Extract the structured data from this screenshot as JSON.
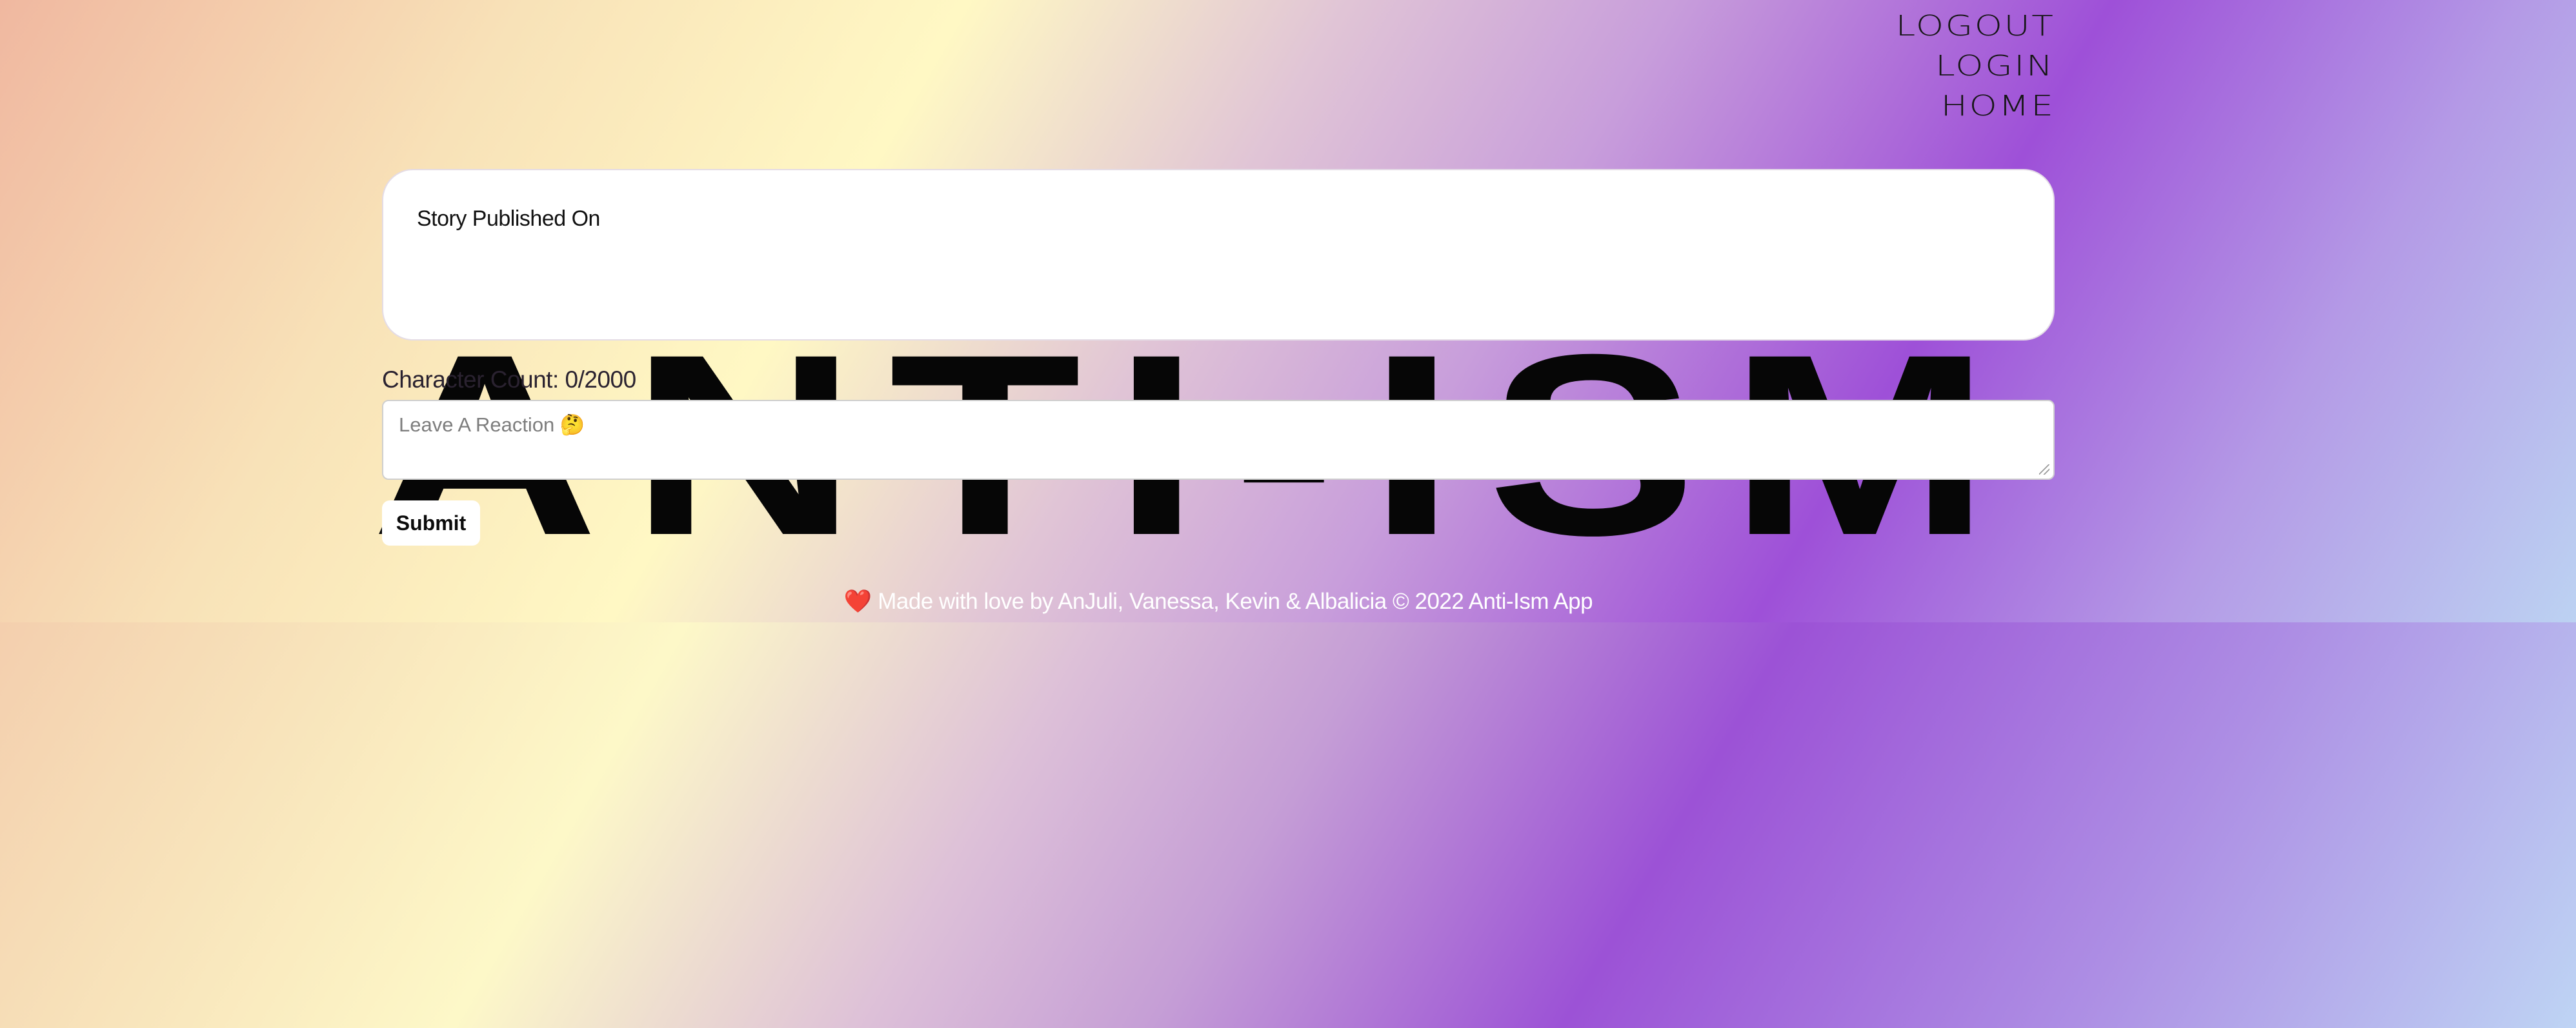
{
  "nav": {
    "logout": "LOGOUT",
    "login": "LOGIN",
    "home": "HOME"
  },
  "hero": {
    "title": "ANTI-ISM"
  },
  "story": {
    "label": "Story Published On"
  },
  "reaction": {
    "character_count": "Character Count: 0/2000",
    "placeholder": "Leave A Reaction 🤔",
    "submit_label": "Submit"
  },
  "footer": {
    "heart_icon": "❤️",
    "text": "Made with love by AnJuli, Vanessa, Kevin & Albalicia © 2022 Anti-Ism App"
  },
  "colors": {
    "gradient": [
      "#f0b8a0",
      "#fff8c4",
      "#c89edb",
      "#9e50d8",
      "#bcd2f2"
    ],
    "text_dark": "#111111",
    "footer_text": "#ffffff"
  }
}
